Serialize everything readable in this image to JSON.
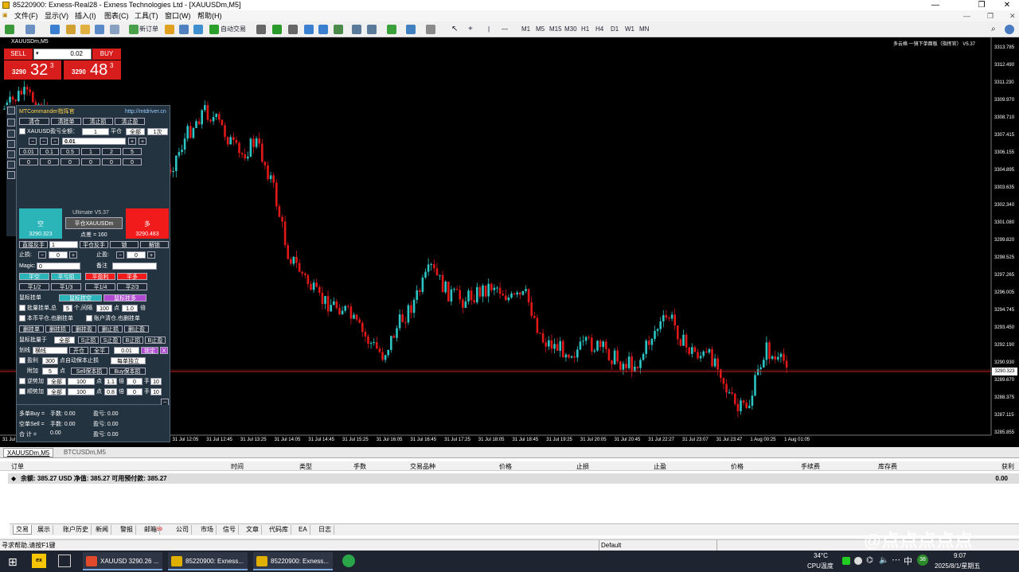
{
  "window": {
    "title": "85220900: Exness-Real28 - Exness Technologies Ltd - [XAUUSDm,M5]",
    "minimize": "—",
    "restore": "❐",
    "close": "✕"
  },
  "menu": [
    "文件(F)",
    "显示(V)",
    "插入(I)",
    "图表(C)",
    "工具(T)",
    "窗口(W)",
    "帮助(H)"
  ],
  "toolbar": {
    "new_order": "新订单",
    "auto_trade": "自动交易",
    "timeframes": [
      "M1",
      "M5",
      "M15",
      "M30",
      "H1",
      "H4",
      "D1",
      "W1",
      "MN"
    ]
  },
  "chart": {
    "title": "XAUUSDm,M5",
    "ea_label": "多云格 一镜下单面板（指挥官） V5.37",
    "current_price": "3290.323",
    "price_labels": [
      "3313.785",
      "3312.490",
      "3311.230",
      "3309.970",
      "3308.710",
      "3307.415",
      "3306.155",
      "3304.895",
      "3303.635",
      "3302.340",
      "3301.080",
      "3299.820",
      "3298.525",
      "3297.265",
      "3296.005",
      "3294.745",
      "3293.450",
      "3292.190",
      "3290.930",
      "3289.670",
      "3288.375",
      "3287.115",
      "3285.855"
    ],
    "time_labels": [
      "31 Jul 2025",
      "31 Jul 09:25",
      "31 Jul 10:05",
      "31 Jul 10:45",
      "31 Jul 11:25",
      "31 Jul 12:05",
      "31 Jul 12:45",
      "31 Jul 13:25",
      "31 Jul 14:05",
      "31 Jul 14:45",
      "31 Jul 15:25",
      "31 Jul 16:05",
      "31 Jul 16:45",
      "31 Jul 17:25",
      "31 Jul 18:05",
      "31 Jul 18:45",
      "31 Jul 19:25",
      "31 Jul 20:05",
      "31 Jul 20:45",
      "31 Jul 22:27",
      "31 Jul 23:07",
      "31 Jul 23:47",
      "1 Aug 00:25",
      "1 Aug 01:05"
    ],
    "colors": {
      "bull": "#2ec4c4",
      "bear": "#e01818",
      "background": "#000000",
      "price_line": "#c02020"
    }
  },
  "trade_panel": {
    "sell": "SELL",
    "buy": "BUY",
    "lot": "0.02",
    "sell_small": "3290",
    "sell_big": "32",
    "sell_sup": "3",
    "buy_small": "3290",
    "buy_big": "48",
    "buy_sup": "3"
  },
  "commander": {
    "title": "MTCommander指挥官",
    "url": "http://mtdriver.cn",
    "row1": [
      "清仓",
      "清挂单",
      "清止损",
      "清止盈"
    ],
    "sym_label": "XAUUSD盈亏全额：",
    "sym_val": "1",
    "pc_label": "平仓",
    "pc_sel": "全部",
    "pc_sel2": "1次",
    "lot_val": "0.01",
    "quick_lots": [
      "0.01",
      "0.1",
      "0.5",
      "1",
      "2",
      "5"
    ],
    "zeros": [
      "0",
      "0",
      "0",
      "0",
      "0",
      "0"
    ],
    "version": "Ultimate V5.37",
    "short_label": "空",
    "short_price": "3290.323",
    "close_btn": "平仓XAUUSDm",
    "spread": "点差 = 160",
    "long_label": "多",
    "long_price": "3290.483",
    "row_reverse": [
      "直接反手",
      "1",
      "平仓反手",
      "锁",
      "解锁"
    ],
    "sl_label": "止损:",
    "sl_val": "0",
    "tp_label": "止盈:",
    "tp_val": "0",
    "magic_label": "Magic:",
    "magic_val": "0",
    "note_label": "备注",
    "row_close": [
      "平空",
      "平亏损",
      "平盈利",
      "平多"
    ],
    "row_fraction": [
      "平1/2",
      "平1/3",
      "平1/4",
      "平2/3"
    ],
    "mouse_label": "鼠标挂单",
    "mouse_short": "鼠标挂空",
    "mouse_long": "鼠标挂多",
    "batch_label": "批量挂单,总",
    "batch_n": "5",
    "batch_mid": "个,间隔",
    "batch_gap": "100",
    "batch_pt": "点",
    "batch_mult": "1.0",
    "batch_x": "倍",
    "cb1": "本币平仓,也删挂单",
    "cb2": "账户清仓,也删挂单",
    "row_del": [
      "删挂单",
      "删挂损",
      "删挂盈",
      "删止损",
      "删止盈"
    ],
    "mouse_batch": "鼠标批量于",
    "mb_sel": "全部",
    "row_mb": [
      "S止损",
      "S止盈",
      "B止损",
      "B止盈"
    ],
    "draw_label": "划线",
    "draw_sel": "横线",
    "draw_open": "开仓",
    "draw_all": "全平",
    "draw_lot": "0.01",
    "draw_lock": "锁定",
    "draw_x": "X",
    "profit_label": "盈利",
    "profit_val": "300",
    "profit_text": "点自动保本止损",
    "profit_sel": "每单独立",
    "add_label": "附加",
    "add_val": "5",
    "add_pt": "点",
    "sell_be": "Sell保本损",
    "buy_be": "Buy保本损",
    "rev_label": "逆势加",
    "rev_sel": "全部",
    "rev_v1": "100",
    "rev_hint": "点",
    "rev_m": "1.1",
    "rev_b": "倍",
    "rev_z": "0",
    "rev_s": "手",
    "rev_n": "10",
    "trend_label": "顺势加",
    "trend_sel": "全部",
    "trend_v1": "100",
    "trend_m": "0.8",
    "trend_z": "0",
    "trend_n": "10",
    "stats": [
      {
        "label": "多单Buy =",
        "lots": "手数: 0.00",
        "pl": "盈亏: 0.00"
      },
      {
        "label": "空单Sell =",
        "lots": "手数: 0.00",
        "pl": "盈亏: 0.00"
      },
      {
        "label": "合    计 =",
        "lots": "0.00",
        "pl": "盈亏: 0.00"
      }
    ]
  },
  "chart_tabs": [
    "XAUUSDm,M5",
    "BTCUSDm,M5"
  ],
  "terminal": {
    "columns": [
      "订单",
      "时间",
      "类型",
      "手数",
      "交易品种",
      "价格",
      "止损",
      "止盈",
      "价格",
      "手续费",
      "库存费",
      "获利"
    ],
    "balance": "余额: 385.27 USD  净值: 385.27  可用预付款: 385.27",
    "balance_profit": "0.00",
    "tabs": [
      "交易",
      "展示",
      "账户历史",
      "新闻",
      "警报",
      "邮箱",
      "公司",
      "市场",
      "信号",
      "文章",
      "代码库",
      "EA",
      "日志"
    ],
    "mail_count": "59",
    "side_label": "终端"
  },
  "status": {
    "help": "寻求帮助,请按F1键",
    "profile": "Default"
  },
  "taskbar": {
    "tasks": [
      "XAUUSD 3290.26 ...",
      "85220900: Exness...",
      "85220900: Exness..."
    ],
    "temp": "34°C",
    "cpu": "CPU温度",
    "ime": "中",
    "badge": "38",
    "time": "9:07",
    "date": "2025/8/1/星期五"
  },
  "watermark": "@点点点点点"
}
